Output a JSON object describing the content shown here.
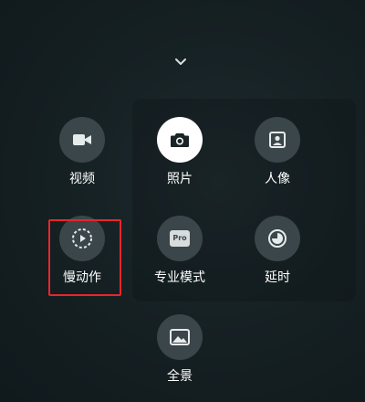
{
  "app": "camera-more-modes",
  "colors": {
    "background": "#121c1f",
    "icon_bg": "#3a4649",
    "icon_active_bg": "#ffffff",
    "highlight": "#e8262b"
  },
  "collapse_icon": "chevron-down-icon",
  "modes": [
    {
      "label": "视频",
      "icon": "video-camera-icon",
      "active": false
    },
    {
      "label": "照片",
      "icon": "camera-icon",
      "active": true
    },
    {
      "label": "人像",
      "icon": "portrait-icon",
      "active": false
    },
    {
      "label": "慢动作",
      "icon": "slow-motion-icon",
      "active": false,
      "highlighted": true
    },
    {
      "label": "专业模式",
      "icon": "pro-icon",
      "icon_text": "Pro",
      "active": false
    },
    {
      "label": "延时",
      "icon": "timelapse-icon",
      "active": false
    },
    {
      "label": "全景",
      "icon": "panorama-icon",
      "active": false
    }
  ]
}
